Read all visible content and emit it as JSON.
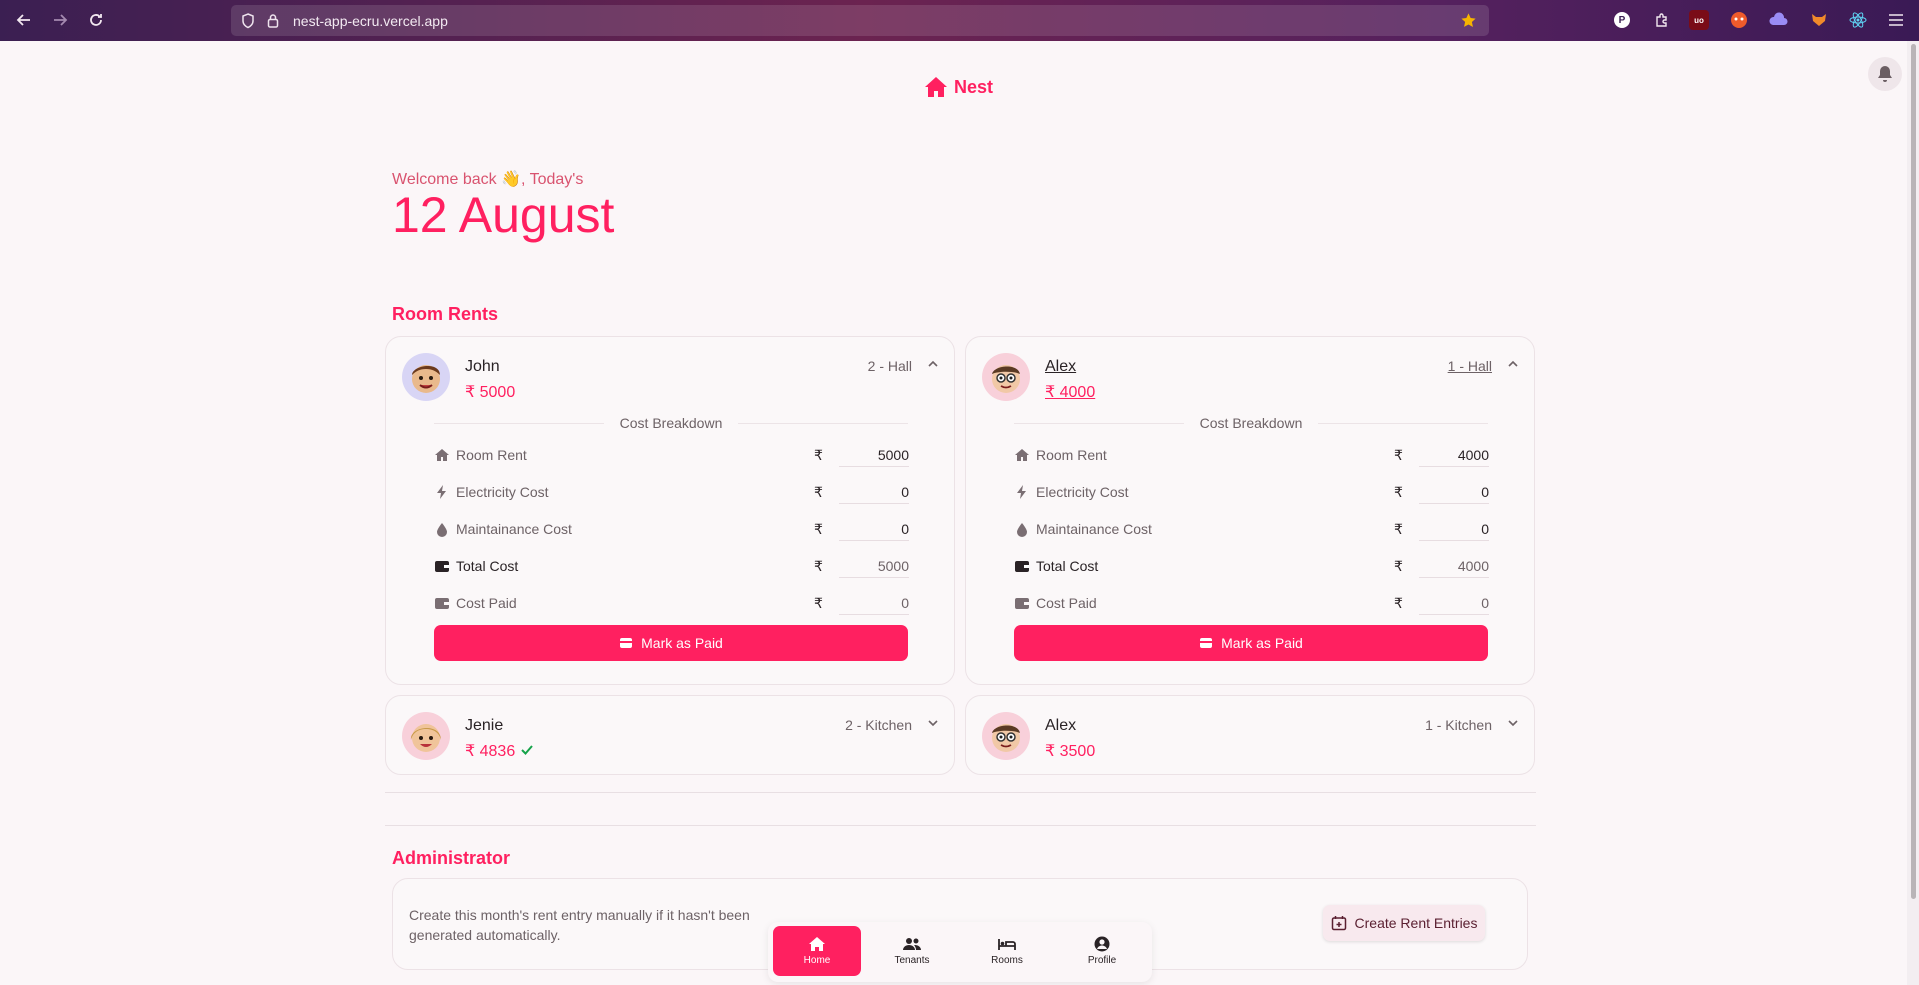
{
  "browser": {
    "url": "nest-app-ecru.vercel.app"
  },
  "app": {
    "brand": "Nest"
  },
  "welcome": {
    "greeting": "Welcome back 👋, Today's",
    "date": "12 August"
  },
  "room_rents": {
    "title": "Room Rents",
    "breakdown_title": "Cost Breakdown",
    "mark_paid_label": "Mark as Paid",
    "rupee": "₹",
    "cards": [
      {
        "name": "John",
        "amount": "₹ 5000",
        "room": "2 - Hall",
        "expanded": true,
        "rows": [
          {
            "label": "Room Rent",
            "value": "5000"
          },
          {
            "label": "Electricity Cost",
            "value": "0"
          },
          {
            "label": "Maintainance Cost",
            "value": "0"
          },
          {
            "label": "Total Cost",
            "value": "5000"
          },
          {
            "label": "Cost Paid",
            "value": "0"
          }
        ]
      },
      {
        "name": "Alex",
        "amount": "₹ 4000",
        "room": "1 - Hall",
        "expanded": true,
        "rows": [
          {
            "label": "Room Rent",
            "value": "4000"
          },
          {
            "label": "Electricity Cost",
            "value": "0"
          },
          {
            "label": "Maintainance Cost",
            "value": "0"
          },
          {
            "label": "Total Cost",
            "value": "4000"
          },
          {
            "label": "Cost Paid",
            "value": "0"
          }
        ]
      },
      {
        "name": "Jenie",
        "amount": "₹ 4836",
        "room": "2 - Kitchen",
        "paid": true,
        "expanded": false
      },
      {
        "name": "Alex",
        "amount": "₹ 3500",
        "room": "1 - Kitchen",
        "expanded": false
      }
    ]
  },
  "admin": {
    "title": "Administrator",
    "description": "Create this month's rent entry manually if it hasn't been generated automatically.",
    "create_label": "Create Rent Entries"
  },
  "bottom_nav": {
    "items": [
      {
        "label": "Home",
        "active": true
      },
      {
        "label": "Tenants"
      },
      {
        "label": "Rooms"
      },
      {
        "label": "Profile"
      }
    ]
  },
  "colors": {
    "accent": "#ff2060",
    "success": "#16a34a"
  }
}
